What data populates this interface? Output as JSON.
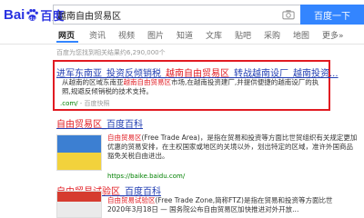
{
  "logo": {
    "part1": "Bai",
    "part2": "百度"
  },
  "search": {
    "query": "越南自由贸易区",
    "button_label": "百度一下"
  },
  "tabs": [
    "网页",
    "资讯",
    "视频",
    "图片",
    "知道",
    "文库",
    "贴吧",
    "采购",
    "地图",
    "更多»"
  ],
  "result_count": "百度为您找到相关结果约6,290,000个",
  "results": [
    {
      "title_a": "进军东南亚_投资反倾销税_",
      "title_b": "越南自由贸易区",
      "title_c": "_转战越南设厂_越南投资...",
      "desc_a": "从越南的区域东南亚",
      "desc_b": "越南自由贸易区",
      "desc_c": "市场,在越南投资建厂,并提供便捷的越南设厂的执照,规避反倾销税的技术支持。",
      "url": ".com/",
      "snapshot": "- 百度快照"
    },
    {
      "title_a": "自由贸易区",
      "title_b": "_百度百科",
      "desc_a": "自由贸易区",
      "desc_b": "(Free Trade Area)，是指在",
      "desc_c": "贸易和投资等方面比世贸组织有关规定更加优惠的",
      "desc_d": "贸易安排，在主权国家或地区的关境以外，划出特定",
      "desc_e": "的区域，准许外国商品豁免关税自由进出。",
      "url": "https://baike.baidu.com/"
    },
    {
      "title_a": "自由贸易试验区",
      "title_b": "_百度百科",
      "desc_a": "自由贸易试验区",
      "desc_b": "(Free Trade Zone,简称FTZ)是指在贸易和投资等方面比世",
      "desc_c": "2020年3月18日 — 国务院",
      "desc_d": "公布自由贸易区加快推进对外开放..."
    }
  ]
}
